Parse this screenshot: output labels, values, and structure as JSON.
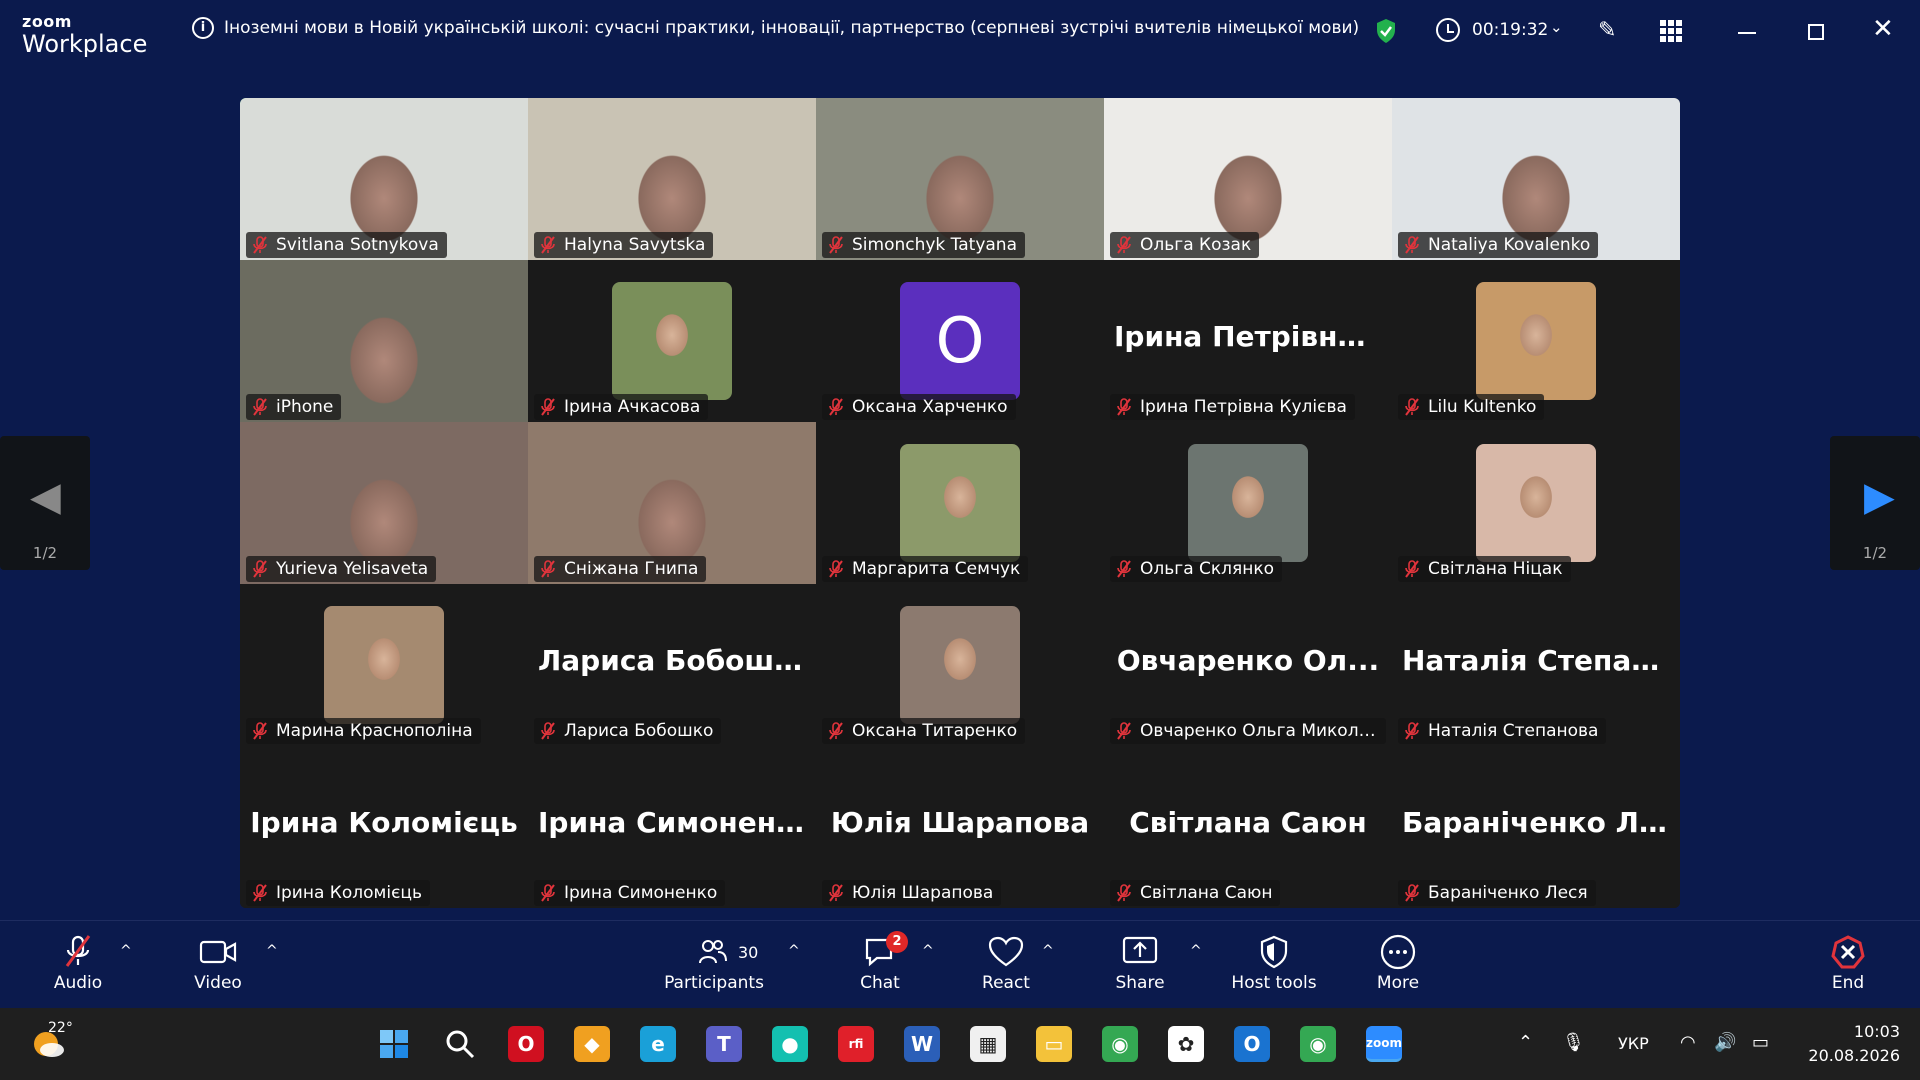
{
  "app": {
    "logo_top": "zoom",
    "logo_bottom": "Workplace"
  },
  "meeting": {
    "title": "Іноземні мови в Новій українській школі: сучасні практики, інновації, партнерство (серпневі зустрічі вчителів німецької мови)",
    "timer": "00:19:32"
  },
  "pagination": {
    "prev_page": "1/2",
    "next_page": "1/2"
  },
  "tiles": [
    {
      "name": "Svitlana Sotnykova",
      "type": "video",
      "active": true,
      "bg": "#d9dcd8"
    },
    {
      "name": "Halyna Savytska",
      "type": "video",
      "bg": "#c9c3b4"
    },
    {
      "name": "Simonchyk Tatyana",
      "type": "video",
      "bg": "#8a8c7f"
    },
    {
      "name": "Ольга Козак",
      "type": "video",
      "bg": "#ecebe8"
    },
    {
      "name": "Nataliya Kovalenko",
      "type": "video",
      "bg": "#dfe3e6"
    },
    {
      "name": "iPhone",
      "type": "video",
      "bg": "#6c6c60"
    },
    {
      "name": "Ірина Ачкасова",
      "type": "photo",
      "bg": "#7a8f5a"
    },
    {
      "name": "Оксана Харченко",
      "type": "avatar",
      "letter": "O"
    },
    {
      "name": "Ірина Петрівна Кулієва",
      "type": "text",
      "bigname": "Ірина  Петрівна..."
    },
    {
      "name": "Lilu Kultenko",
      "type": "photo",
      "bg": "#c79a68"
    },
    {
      "name": "Yurieva Yelisaveta",
      "type": "video",
      "bg": "#7d6a62"
    },
    {
      "name": "Сніжана Гнипа",
      "type": "video",
      "bg": "#8f7a6b"
    },
    {
      "name": "Маргарита Семчук",
      "type": "photo",
      "bg": "#8c9a6a"
    },
    {
      "name": "Ольга Склянко",
      "type": "photo",
      "bg": "#6c7570"
    },
    {
      "name": "Світлана Ніцак",
      "type": "photo",
      "bg": "#d8b8a8"
    },
    {
      "name": "Марина Краснополіна",
      "type": "photo",
      "bg": "#a58a70"
    },
    {
      "name": "Лариса Бобошко",
      "type": "text",
      "bigname": "Лариса Бобошко"
    },
    {
      "name": "Оксана Титаренко",
      "type": "photo",
      "bg": "#8c7a6f"
    },
    {
      "name": "Овчаренко Ольга Миколаї...",
      "type": "text",
      "bigname": "Овчаренко  Ол..."
    },
    {
      "name": "Наталія Степанова",
      "type": "text",
      "bigname": "Наталія  Степан..."
    },
    {
      "name": "Ірина Коломієць",
      "type": "text",
      "bigname": "Ірина Коломієць"
    },
    {
      "name": "Ірина Симоненко",
      "type": "text",
      "bigname": "Ірина  Симонен..."
    },
    {
      "name": "Юлія Шарапова",
      "type": "text",
      "bigname": "Юлія Шарапова"
    },
    {
      "name": "Світлана Саюн",
      "type": "text",
      "bigname": "Світлана Саюн"
    },
    {
      "name": "Бараніченко Леся",
      "type": "text",
      "bigname": "Бараніченко Л..."
    }
  ],
  "toolbar": {
    "audio": "Audio",
    "video": "Video",
    "participants": "Participants",
    "participants_count": "30",
    "chat": "Chat",
    "chat_badge": "2",
    "react": "React",
    "share": "Share",
    "host_tools": "Host tools",
    "more": "More",
    "end": "End"
  },
  "taskbar": {
    "weather_temp": "22°",
    "lang": "УКР",
    "time": "10:03",
    "date": "20.08.2026",
    "apps": [
      {
        "id": "start",
        "color": "#1e90ff",
        "glyph": ""
      },
      {
        "id": "search",
        "color": "transparent",
        "glyph": ""
      },
      {
        "id": "opera",
        "color": "#d01020",
        "glyph": "O"
      },
      {
        "id": "app-yellow",
        "color": "#f0a020",
        "glyph": "◆"
      },
      {
        "id": "edge",
        "color": "#1aa0d8",
        "glyph": "e"
      },
      {
        "id": "teams",
        "color": "#5b5fc7",
        "glyph": "T"
      },
      {
        "id": "app-teal",
        "color": "#13c0b0",
        "glyph": "●"
      },
      {
        "id": "rfi",
        "color": "#e0202a",
        "glyph": "rfi"
      },
      {
        "id": "word",
        "color": "#2b5fb8",
        "glyph": "W"
      },
      {
        "id": "store",
        "color": "#f0f0f0",
        "glyph": "▦"
      },
      {
        "id": "explorer",
        "color": "#f3c23a",
        "glyph": "▭"
      },
      {
        "id": "chrome",
        "color": "#34a853",
        "glyph": "◉"
      },
      {
        "id": "chatgpt",
        "color": "#ffffff",
        "glyph": "✿"
      },
      {
        "id": "outlook",
        "color": "#1a73d0",
        "glyph": "O"
      },
      {
        "id": "chrome2",
        "color": "#34a853",
        "glyph": "◉"
      },
      {
        "id": "zoom",
        "color": "#2d8cff",
        "glyph": "zoom"
      }
    ]
  },
  "colors": {
    "accent": "#2d8cff",
    "active_speaker": "#23d18b",
    "mute_red": "#e0343c",
    "background": "#0b1a4d"
  }
}
